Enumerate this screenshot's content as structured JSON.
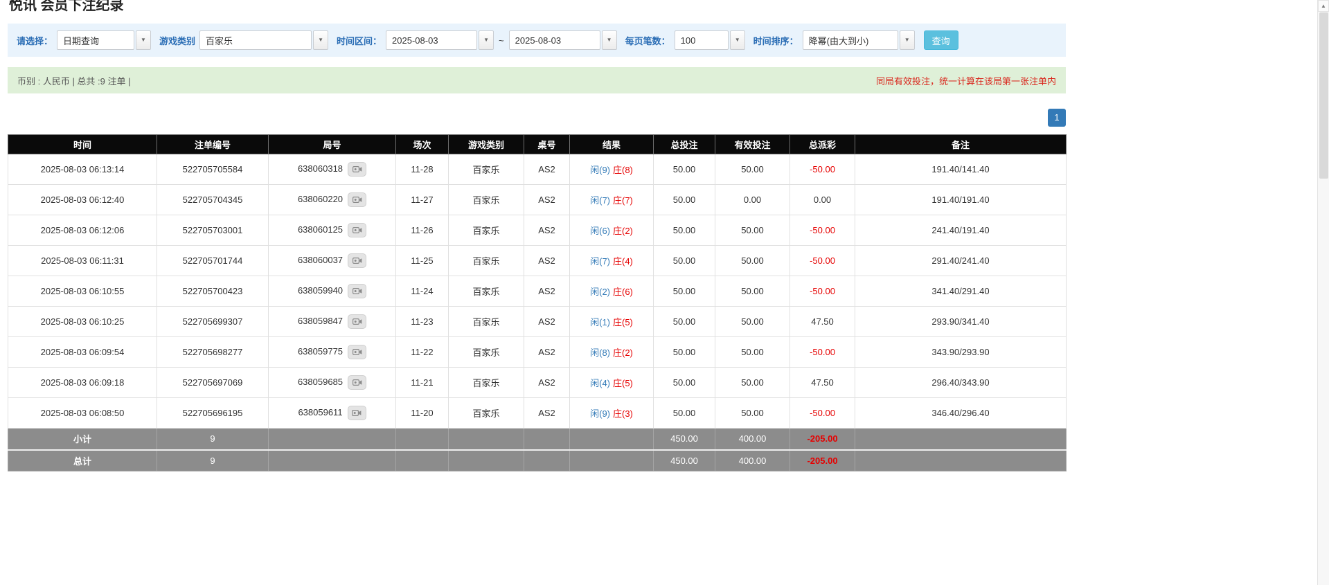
{
  "icons": {
    "dropdown_caret": "▼",
    "scroll_up": "▲",
    "round_detail": "video-camera-icon"
  },
  "page": {
    "title": "悦讯 会员下注纪录"
  },
  "filters": {
    "select_label": "请选择：",
    "select_value": "日期查询",
    "game_type_label": "游戏类别",
    "game_type_value": "百家乐",
    "time_range_label": "时间区间：",
    "date_from": "2025-08-03",
    "tilde": "~",
    "date_to": "2025-08-03",
    "page_size_label": "每页笔数：",
    "page_size_value": "100",
    "sort_label": "时间排序：",
    "sort_value": "降幂(由大到小)",
    "search_button": "查询"
  },
  "summary": {
    "left": "币别 : 人民币 | 总共 :9 注单 |",
    "right": "同局有效投注，统一计算在该局第一张注单内"
  },
  "pagination": {
    "page": "1"
  },
  "table": {
    "headers": [
      "时间",
      "注单编号",
      "局号",
      "场次",
      "游戏类别",
      "桌号",
      "结果",
      "总投注",
      "有效投注",
      "总派彩",
      "备注"
    ],
    "rows": [
      {
        "time": "2025-08-03 06:13:14",
        "bet_id": "522705705584",
        "round_id": "638060318",
        "session": "11-28",
        "game": "百家乐",
        "table": "AS2",
        "result_player": "闲(9)",
        "result_banker": "庄(8)",
        "total_bet": "50.00",
        "valid_bet": "50.00",
        "payout": "-50.00",
        "remark": "191.40/141.40"
      },
      {
        "time": "2025-08-03 06:12:40",
        "bet_id": "522705704345",
        "round_id": "638060220",
        "session": "11-27",
        "game": "百家乐",
        "table": "AS2",
        "result_player": "闲(7)",
        "result_banker": "庄(7)",
        "total_bet": "50.00",
        "valid_bet": "0.00",
        "payout": "0.00",
        "remark": "191.40/191.40"
      },
      {
        "time": "2025-08-03 06:12:06",
        "bet_id": "522705703001",
        "round_id": "638060125",
        "session": "11-26",
        "game": "百家乐",
        "table": "AS2",
        "result_player": "闲(6)",
        "result_banker": "庄(2)",
        "total_bet": "50.00",
        "valid_bet": "50.00",
        "payout": "-50.00",
        "remark": "241.40/191.40"
      },
      {
        "time": "2025-08-03 06:11:31",
        "bet_id": "522705701744",
        "round_id": "638060037",
        "session": "11-25",
        "game": "百家乐",
        "table": "AS2",
        "result_player": "闲(7)",
        "result_banker": "庄(4)",
        "total_bet": "50.00",
        "valid_bet": "50.00",
        "payout": "-50.00",
        "remark": "291.40/241.40"
      },
      {
        "time": "2025-08-03 06:10:55",
        "bet_id": "522705700423",
        "round_id": "638059940",
        "session": "11-24",
        "game": "百家乐",
        "table": "AS2",
        "result_player": "闲(2)",
        "result_banker": "庄(6)",
        "total_bet": "50.00",
        "valid_bet": "50.00",
        "payout": "-50.00",
        "remark": "341.40/291.40"
      },
      {
        "time": "2025-08-03 06:10:25",
        "bet_id": "522705699307",
        "round_id": "638059847",
        "session": "11-23",
        "game": "百家乐",
        "table": "AS2",
        "result_player": "闲(1)",
        "result_banker": "庄(5)",
        "total_bet": "50.00",
        "valid_bet": "50.00",
        "payout": "47.50",
        "remark": "293.90/341.40"
      },
      {
        "time": "2025-08-03 06:09:54",
        "bet_id": "522705698277",
        "round_id": "638059775",
        "session": "11-22",
        "game": "百家乐",
        "table": "AS2",
        "result_player": "闲(8)",
        "result_banker": "庄(2)",
        "total_bet": "50.00",
        "valid_bet": "50.00",
        "payout": "-50.00",
        "remark": "343.90/293.90"
      },
      {
        "time": "2025-08-03 06:09:18",
        "bet_id": "522705697069",
        "round_id": "638059685",
        "session": "11-21",
        "game": "百家乐",
        "table": "AS2",
        "result_player": "闲(4)",
        "result_banker": "庄(5)",
        "total_bet": "50.00",
        "valid_bet": "50.00",
        "payout": "47.50",
        "remark": "296.40/343.90"
      },
      {
        "time": "2025-08-03 06:08:50",
        "bet_id": "522705696195",
        "round_id": "638059611",
        "session": "11-20",
        "game": "百家乐",
        "table": "AS2",
        "result_player": "闲(9)",
        "result_banker": "庄(3)",
        "total_bet": "50.00",
        "valid_bet": "50.00",
        "payout": "-50.00",
        "remark": "346.40/296.40"
      }
    ],
    "subtotal": {
      "label": "小计",
      "count": "9",
      "total_bet": "450.00",
      "valid_bet": "400.00",
      "payout": "-205.00"
    },
    "total": {
      "label": "总计",
      "count": "9",
      "total_bet": "450.00",
      "valid_bet": "400.00",
      "payout": "-205.00"
    }
  }
}
